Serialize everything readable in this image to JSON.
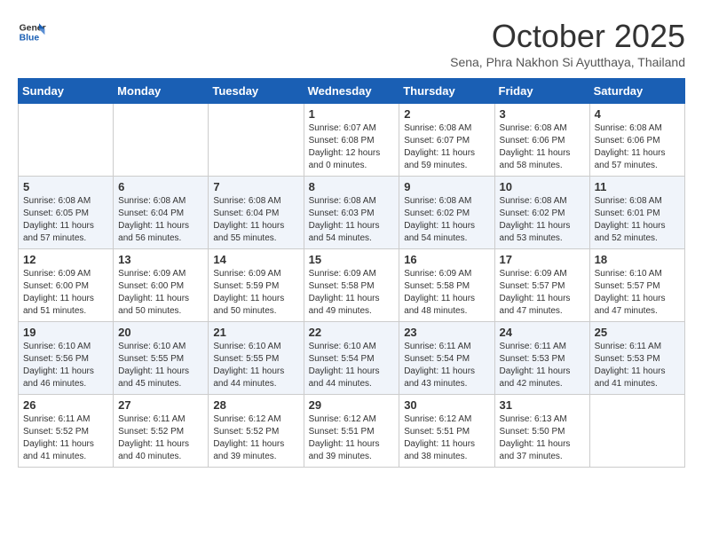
{
  "header": {
    "logo_line1": "General",
    "logo_line2": "Blue",
    "month": "October 2025",
    "location": "Sena, Phra Nakhon Si Ayutthaya, Thailand"
  },
  "days_of_week": [
    "Sunday",
    "Monday",
    "Tuesday",
    "Wednesday",
    "Thursday",
    "Friday",
    "Saturday"
  ],
  "weeks": [
    [
      {
        "day": "",
        "info": ""
      },
      {
        "day": "",
        "info": ""
      },
      {
        "day": "",
        "info": ""
      },
      {
        "day": "1",
        "info": "Sunrise: 6:07 AM\nSunset: 6:08 PM\nDaylight: 12 hours\nand 0 minutes."
      },
      {
        "day": "2",
        "info": "Sunrise: 6:08 AM\nSunset: 6:07 PM\nDaylight: 11 hours\nand 59 minutes."
      },
      {
        "day": "3",
        "info": "Sunrise: 6:08 AM\nSunset: 6:06 PM\nDaylight: 11 hours\nand 58 minutes."
      },
      {
        "day": "4",
        "info": "Sunrise: 6:08 AM\nSunset: 6:06 PM\nDaylight: 11 hours\nand 57 minutes."
      }
    ],
    [
      {
        "day": "5",
        "info": "Sunrise: 6:08 AM\nSunset: 6:05 PM\nDaylight: 11 hours\nand 57 minutes."
      },
      {
        "day": "6",
        "info": "Sunrise: 6:08 AM\nSunset: 6:04 PM\nDaylight: 11 hours\nand 56 minutes."
      },
      {
        "day": "7",
        "info": "Sunrise: 6:08 AM\nSunset: 6:04 PM\nDaylight: 11 hours\nand 55 minutes."
      },
      {
        "day": "8",
        "info": "Sunrise: 6:08 AM\nSunset: 6:03 PM\nDaylight: 11 hours\nand 54 minutes."
      },
      {
        "day": "9",
        "info": "Sunrise: 6:08 AM\nSunset: 6:02 PM\nDaylight: 11 hours\nand 54 minutes."
      },
      {
        "day": "10",
        "info": "Sunrise: 6:08 AM\nSunset: 6:02 PM\nDaylight: 11 hours\nand 53 minutes."
      },
      {
        "day": "11",
        "info": "Sunrise: 6:08 AM\nSunset: 6:01 PM\nDaylight: 11 hours\nand 52 minutes."
      }
    ],
    [
      {
        "day": "12",
        "info": "Sunrise: 6:09 AM\nSunset: 6:00 PM\nDaylight: 11 hours\nand 51 minutes."
      },
      {
        "day": "13",
        "info": "Sunrise: 6:09 AM\nSunset: 6:00 PM\nDaylight: 11 hours\nand 50 minutes."
      },
      {
        "day": "14",
        "info": "Sunrise: 6:09 AM\nSunset: 5:59 PM\nDaylight: 11 hours\nand 50 minutes."
      },
      {
        "day": "15",
        "info": "Sunrise: 6:09 AM\nSunset: 5:58 PM\nDaylight: 11 hours\nand 49 minutes."
      },
      {
        "day": "16",
        "info": "Sunrise: 6:09 AM\nSunset: 5:58 PM\nDaylight: 11 hours\nand 48 minutes."
      },
      {
        "day": "17",
        "info": "Sunrise: 6:09 AM\nSunset: 5:57 PM\nDaylight: 11 hours\nand 47 minutes."
      },
      {
        "day": "18",
        "info": "Sunrise: 6:10 AM\nSunset: 5:57 PM\nDaylight: 11 hours\nand 47 minutes."
      }
    ],
    [
      {
        "day": "19",
        "info": "Sunrise: 6:10 AM\nSunset: 5:56 PM\nDaylight: 11 hours\nand 46 minutes."
      },
      {
        "day": "20",
        "info": "Sunrise: 6:10 AM\nSunset: 5:55 PM\nDaylight: 11 hours\nand 45 minutes."
      },
      {
        "day": "21",
        "info": "Sunrise: 6:10 AM\nSunset: 5:55 PM\nDaylight: 11 hours\nand 44 minutes."
      },
      {
        "day": "22",
        "info": "Sunrise: 6:10 AM\nSunset: 5:54 PM\nDaylight: 11 hours\nand 44 minutes."
      },
      {
        "day": "23",
        "info": "Sunrise: 6:11 AM\nSunset: 5:54 PM\nDaylight: 11 hours\nand 43 minutes."
      },
      {
        "day": "24",
        "info": "Sunrise: 6:11 AM\nSunset: 5:53 PM\nDaylight: 11 hours\nand 42 minutes."
      },
      {
        "day": "25",
        "info": "Sunrise: 6:11 AM\nSunset: 5:53 PM\nDaylight: 11 hours\nand 41 minutes."
      }
    ],
    [
      {
        "day": "26",
        "info": "Sunrise: 6:11 AM\nSunset: 5:52 PM\nDaylight: 11 hours\nand 41 minutes."
      },
      {
        "day": "27",
        "info": "Sunrise: 6:11 AM\nSunset: 5:52 PM\nDaylight: 11 hours\nand 40 minutes."
      },
      {
        "day": "28",
        "info": "Sunrise: 6:12 AM\nSunset: 5:52 PM\nDaylight: 11 hours\nand 39 minutes."
      },
      {
        "day": "29",
        "info": "Sunrise: 6:12 AM\nSunset: 5:51 PM\nDaylight: 11 hours\nand 39 minutes."
      },
      {
        "day": "30",
        "info": "Sunrise: 6:12 AM\nSunset: 5:51 PM\nDaylight: 11 hours\nand 38 minutes."
      },
      {
        "day": "31",
        "info": "Sunrise: 6:13 AM\nSunset: 5:50 PM\nDaylight: 11 hours\nand 37 minutes."
      },
      {
        "day": "",
        "info": ""
      }
    ]
  ]
}
